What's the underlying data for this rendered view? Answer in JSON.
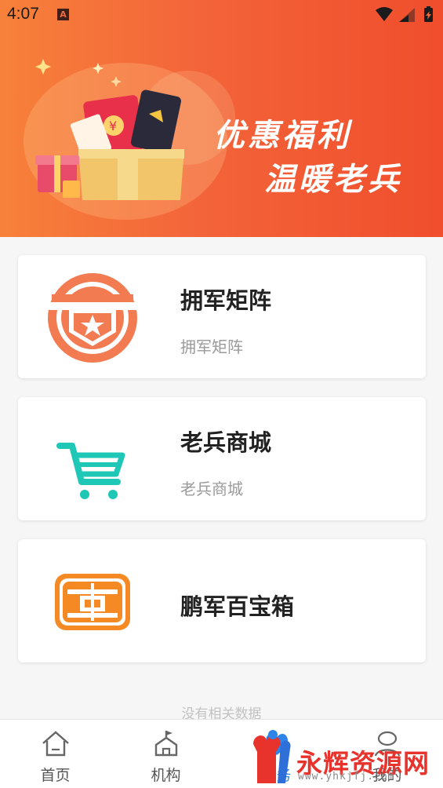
{
  "status_bar": {
    "time": "4:07",
    "notification_icon": "A"
  },
  "banner": {
    "line1": "优惠福利",
    "line2": "温暖老兵",
    "colors": {
      "start": "#f7813a",
      "end": "#f04e2c"
    }
  },
  "cards": [
    {
      "title": "拥军矩阵",
      "subtitle": "拥军矩阵",
      "icon": "shield-star-icon",
      "icon_color": "#f27b52"
    },
    {
      "title": "老兵商城",
      "subtitle": "老兵商城",
      "icon": "shopping-cart-icon",
      "icon_color": "#1fc7b6"
    },
    {
      "title": "鹏军百宝箱",
      "subtitle": "",
      "icon": "treasure-box-icon",
      "icon_color": "#f58a25"
    }
  ],
  "empty_text": "没有相关数据",
  "tabbar": {
    "tabs": [
      {
        "label": "首页",
        "icon": "home-icon"
      },
      {
        "label": "机构",
        "icon": "organization-icon"
      },
      {
        "label": "服务",
        "icon": "service-icon",
        "active": true
      },
      {
        "label": "我的",
        "icon": "profile-icon"
      }
    ],
    "active_color": "#2f84ea"
  },
  "watermark": {
    "text": "永辉资源网",
    "url": "www.yhkjfj.com"
  }
}
